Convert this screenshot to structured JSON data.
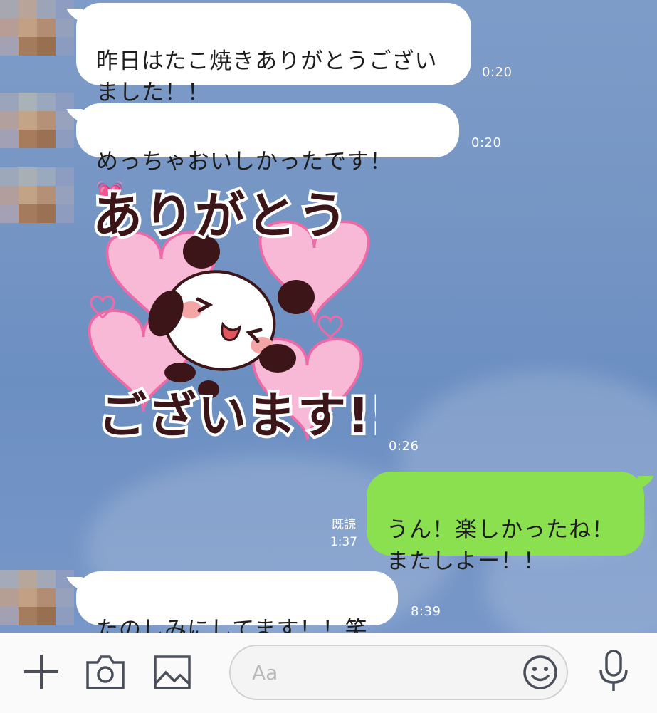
{
  "messages": [
    {
      "text": "昨日はたこ焼きありがとうござい\nました！！",
      "time": "0:20"
    },
    {
      "text": "めっちゃおいしかったです！",
      "emoji": "💓",
      "time": "0:20"
    },
    {
      "sticker_line1": "ありがとう",
      "sticker_line2": "ございます!!",
      "time": "0:26"
    },
    {
      "text": "うん！楽しかったね！\nまたしよー！！",
      "read": "既読",
      "time": "1:37"
    },
    {
      "text": "たのしみにしてます！！笑",
      "time": "8:39"
    }
  ],
  "input": {
    "placeholder": "Aa"
  },
  "icons": [
    "plus-icon",
    "camera-icon",
    "image-icon",
    "smiley-icon",
    "microphone-icon"
  ],
  "colors": {
    "chat_bg": "#7595c4",
    "my_bubble": "#8ae04e",
    "their_bubble": "#ffffff"
  }
}
